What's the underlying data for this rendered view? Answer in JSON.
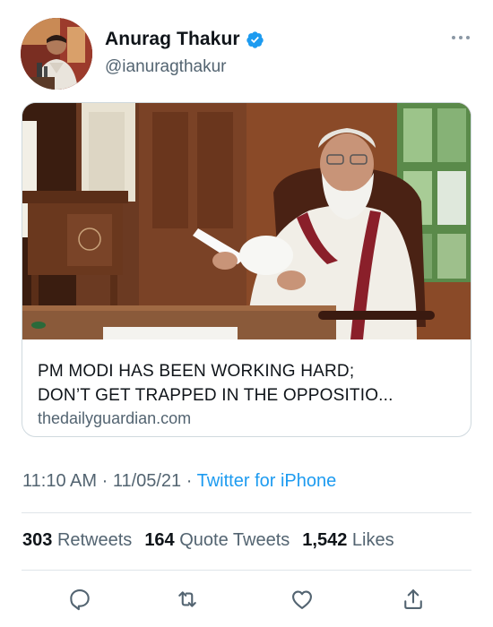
{
  "author": {
    "name": "Anurag Thakur",
    "handle": "@ianuragthakur",
    "verified": true,
    "avatar_icon": "profile-photo"
  },
  "card": {
    "title_line1": "PM MODI HAS BEEN WORKING HARD;",
    "title_line2": "DON’T GET TRAPPED IN THE OPPOSITIO...",
    "domain": "thedailyguardian.com",
    "image": "photo-man-reading-papers"
  },
  "meta": {
    "time": "11:10 AM",
    "separator": " · ",
    "date": "11/05/21",
    "source": "Twitter for iPhone"
  },
  "stats": {
    "retweets_count": "303",
    "retweets_label": "Retweets",
    "quotes_count": "164",
    "quotes_label": "Quote Tweets",
    "likes_count": "1,542",
    "likes_label": "Likes"
  },
  "actions": {
    "icons": [
      "reply-icon",
      "retweet-icon",
      "like-icon",
      "share-icon"
    ]
  },
  "colors": {
    "accent": "#1d9bf0",
    "text_primary": "#0f1419",
    "text_secondary": "#536471",
    "border": "#cfd9de"
  }
}
